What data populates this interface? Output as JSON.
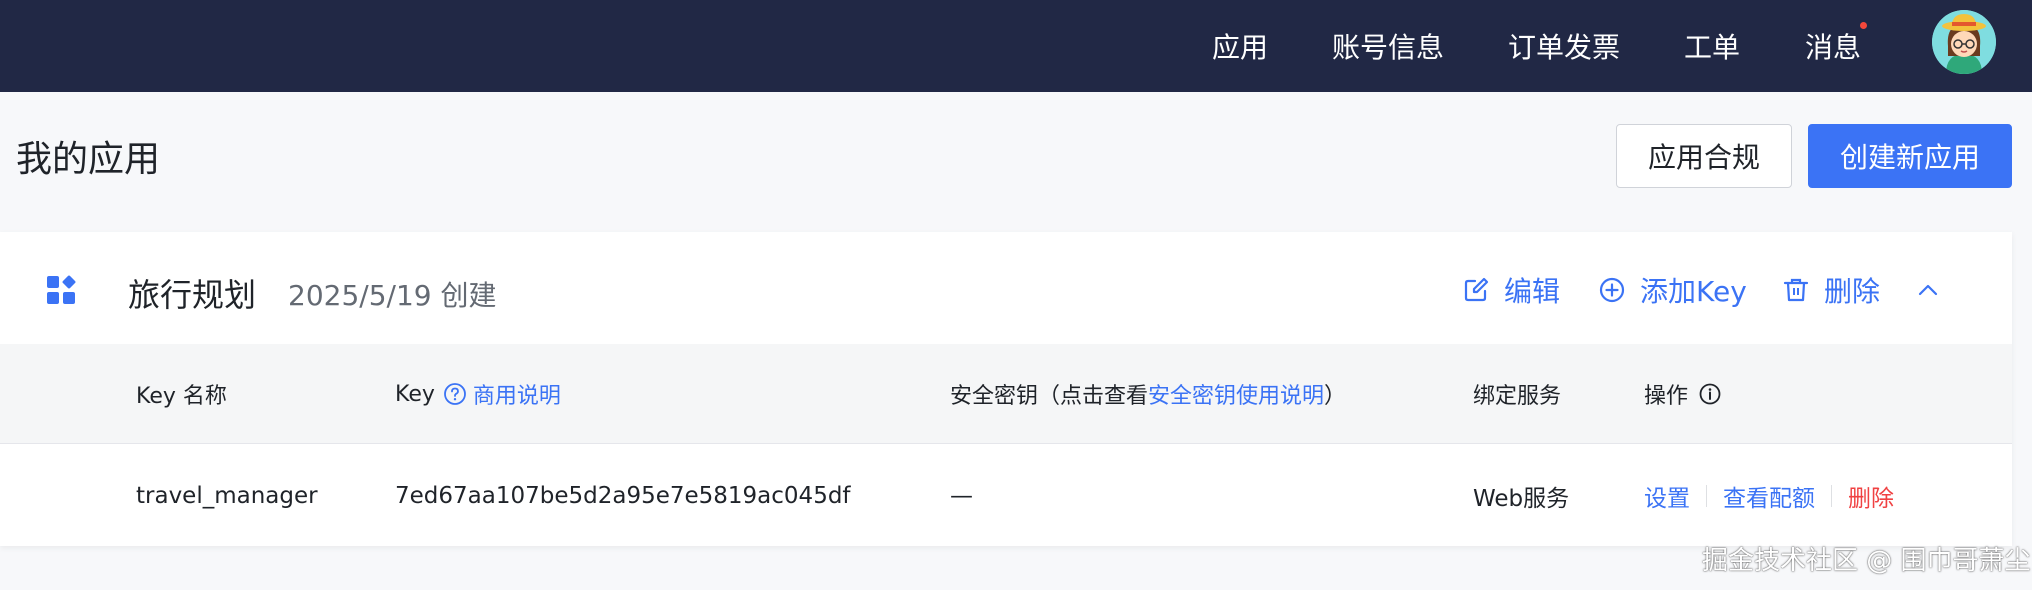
{
  "topnav": {
    "items": [
      "应用",
      "账号信息",
      "订单发票",
      "工单",
      "消息"
    ],
    "has_unread_messages": true
  },
  "page": {
    "title": "我的应用",
    "compliance_button": "应用合规",
    "create_button": "创建新应用"
  },
  "app": {
    "name": "旅行规划",
    "created": "2025/5/19 创建",
    "actions": {
      "edit": "编辑",
      "add_key": "添加Key",
      "delete": "删除"
    }
  },
  "table": {
    "headers": {
      "key_name": "Key 名称",
      "key": "Key",
      "key_link": "商用说明",
      "secret_prefix": "安全密钥（点击查看",
      "secret_link": "安全密钥使用说明",
      "secret_suffix": "）",
      "service": "绑定服务",
      "ops": "操作"
    },
    "rows": [
      {
        "name": "travel_manager",
        "key": "7ed67aa107be5d2a95e7e5819ac045df",
        "secret": "—",
        "service": "Web服务",
        "ops": [
          "设置",
          "查看配额",
          "删除"
        ]
      }
    ]
  },
  "watermark": "掘金技术社区 @ 围巾哥萧尘",
  "colors": {
    "topbar": "#212845",
    "primary": "#3b73f5",
    "danger": "#f04142",
    "badge": "#f5483b"
  }
}
